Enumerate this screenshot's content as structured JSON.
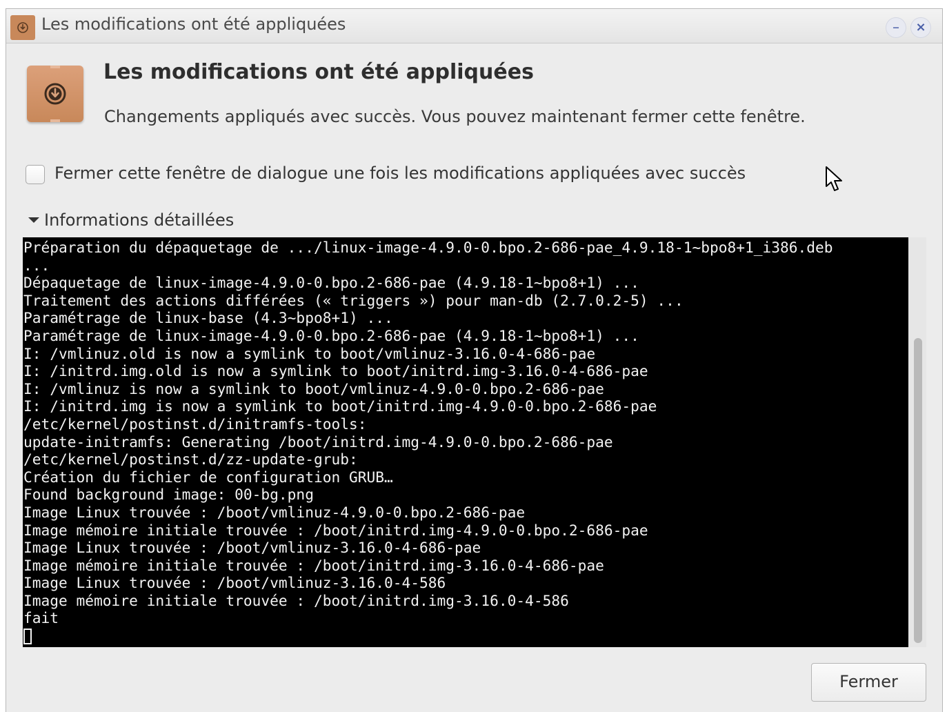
{
  "window": {
    "title": "Les modifications ont été appliquées",
    "app_icon": "package-install-icon",
    "minimize_glyph": "–",
    "close_glyph": "×"
  },
  "header": {
    "icon": "package-download-icon",
    "title": "Les modifications ont été appliquées",
    "subtitle": "Changements appliqués avec succès. Vous pouvez maintenant fermer cette fenêtre."
  },
  "options": {
    "auto_close_checked": false,
    "auto_close_label": "Fermer cette fenêtre de dialogue une fois les modifications appliquées avec succès"
  },
  "details": {
    "expanded": true,
    "label": "Informations détaillées",
    "log_lines": [
      "Préparation du dépaquetage de .../linux-image-4.9.0-0.bpo.2-686-pae_4.9.18-1~bpo8+1_i386.deb",
      "...",
      "Dépaquetage de linux-image-4.9.0-0.bpo.2-686-pae (4.9.18-1~bpo8+1) ...",
      "Traitement des actions différées (« triggers ») pour man-db (2.7.0.2-5) ...",
      "Paramétrage de linux-base (4.3~bpo8+1) ...",
      "Paramétrage de linux-image-4.9.0-0.bpo.2-686-pae (4.9.18-1~bpo8+1) ...",
      "I: /vmlinuz.old is now a symlink to boot/vmlinuz-3.16.0-4-686-pae",
      "I: /initrd.img.old is now a symlink to boot/initrd.img-3.16.0-4-686-pae",
      "I: /vmlinuz is now a symlink to boot/vmlinuz-4.9.0-0.bpo.2-686-pae",
      "I: /initrd.img is now a symlink to boot/initrd.img-4.9.0-0.bpo.2-686-pae",
      "/etc/kernel/postinst.d/initramfs-tools:",
      "update-initramfs: Generating /boot/initrd.img-4.9.0-0.bpo.2-686-pae",
      "/etc/kernel/postinst.d/zz-update-grub:",
      "Création du fichier de configuration GRUB…",
      "Found background image: 00-bg.png",
      "Image Linux trouvée : /boot/vmlinuz-4.9.0-0.bpo.2-686-pae",
      "Image mémoire initiale trouvée : /boot/initrd.img-4.9.0-0.bpo.2-686-pae",
      "Image Linux trouvée : /boot/vmlinuz-3.16.0-4-686-pae",
      "Image mémoire initiale trouvée : /boot/initrd.img-3.16.0-4-686-pae",
      "Image Linux trouvée : /boot/vmlinuz-3.16.0-4-586",
      "Image mémoire initiale trouvée : /boot/initrd.img-3.16.0-4-586",
      "fait"
    ]
  },
  "footer": {
    "close_label": "Fermer"
  },
  "colors": {
    "window_bg": "#ececec",
    "terminal_bg": "#000000",
    "terminal_fg": "#f2f2f2",
    "icon_brown": "#c8885a",
    "wm_button_glyph": "#4a5fa8"
  }
}
